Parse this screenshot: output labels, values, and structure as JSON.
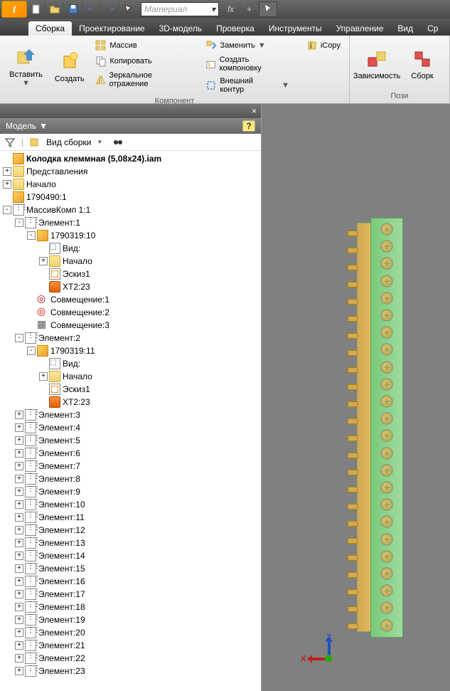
{
  "qat": {
    "material_placeholder": "Материал"
  },
  "tabs": [
    "Сборка",
    "Проектирование",
    "3D-модель",
    "Проверка",
    "Инструменты",
    "Управление",
    "Вид",
    "Ср"
  ],
  "active_tab": 0,
  "ribbon": {
    "insert": "Вставить",
    "create": "Создать",
    "pattern": "Массив",
    "copy": "Копировать",
    "mirror": "Зеркальное отражение",
    "replace": "Заменить",
    "create_layout": "Создать компоновку",
    "external_contour": "Внешний контур",
    "icopy": "iCopy",
    "constraints": "Зависимость",
    "assembly": "Сборк",
    "group_component": "Компонент",
    "group_position": "Пози"
  },
  "panel": {
    "title": "Модель",
    "view_mode": "Вид сборки"
  },
  "tree": {
    "root": "Колодка клеммная (5,08x24).iam",
    "representations": "Представления",
    "origin": "Начало",
    "part_num": "1790490:1",
    "pattern": "МассивКомп 1:1",
    "element": "Элемент:",
    "subpart_10": "1790319:10",
    "subpart_11": "1790319:11",
    "view": "Вид:",
    "origin_sub": "Начало",
    "sketch": "Эскиз1",
    "xt": "XT2:23",
    "mate1": "Совмещение:1",
    "mate2": "Совмещение:2",
    "mate3": "Совмещение:3",
    "elements_range": [
      3,
      4,
      5,
      6,
      7,
      8,
      9,
      10,
      11,
      12,
      13,
      14,
      15,
      16,
      17,
      18,
      19,
      20,
      21,
      22,
      23
    ]
  },
  "axis": {
    "x": "X",
    "z": "Z"
  }
}
